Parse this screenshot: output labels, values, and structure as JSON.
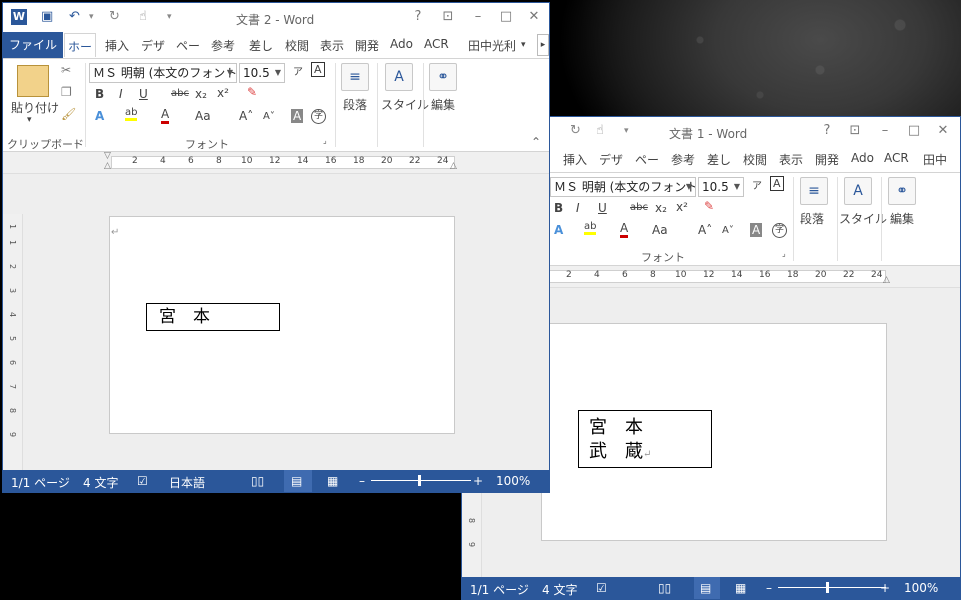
{
  "colors": {
    "accent": "#2b579a",
    "status_bar": "#2b579a"
  },
  "icons": [
    "word-icon",
    "save-icon",
    "undo-icon",
    "redo-icon",
    "touch-mode-icon",
    "customize-icon",
    "help-icon",
    "ribbon-display-icon",
    "minimize-icon",
    "maximize-icon",
    "close-icon",
    "paste-icon",
    "cut-icon",
    "copy-icon",
    "format-painter-icon",
    "clear-format-icon",
    "phonetic-icon",
    "enclose-icon",
    "find-binoculars-icon",
    "paragraph-icon",
    "styles-icon"
  ],
  "back_window": {
    "title": "文書 1 - Word",
    "tabs": [
      "挿入",
      "デザ",
      "ペー",
      "参考",
      "差し",
      "校閲",
      "表示",
      "開発",
      "Ado",
      "ACR",
      "田中"
    ],
    "font_name": "ＭＳ 明朝 (本文のフォント",
    "font_size": "10.5",
    "groups": {
      "font": "フォント",
      "paragraph": "段落",
      "styles": "スタイル",
      "editing": "編集"
    },
    "ruler_numbers": [
      "2",
      "4",
      "6",
      "8",
      "10",
      "12",
      "14",
      "16",
      "18",
      "20",
      "22",
      "24"
    ],
    "vruler_numbers": [
      "8",
      "9"
    ],
    "textbox_lines": [
      "宮　本",
      "武　蔵"
    ],
    "status": {
      "page": "1/1 ページ",
      "words": "4 文字",
      "zoom": "100%"
    }
  },
  "front_window": {
    "title": "文書 2 - Word",
    "file_tab": "ファイル",
    "home_tab": "ホー",
    "tabs": [
      "挿入",
      "デザ",
      "ペー",
      "参考",
      "差し",
      "校閲",
      "表示",
      "開発",
      "Ado",
      "ACR"
    ],
    "user": "田中光利",
    "font_name": "ＭＳ 明朝 (本文のフォント",
    "font_size": "10.5",
    "paste_label": "貼り付け",
    "groups": {
      "clipboard": "クリップボード",
      "font": "フォント",
      "paragraph": "段落",
      "styles": "スタイル",
      "editing": "編集"
    },
    "ruler_numbers": [
      "2",
      "4",
      "6",
      "8",
      "10",
      "12",
      "14",
      "16",
      "18",
      "20",
      "22",
      "24"
    ],
    "vruler_numbers": [
      "1",
      "1",
      "2",
      "3",
      "4",
      "5",
      "6",
      "7",
      "8",
      "9"
    ],
    "textbox_text": "宮　本",
    "status": {
      "page": "1/1 ページ",
      "words": "4 文字",
      "language": "日本語",
      "zoom": "100%"
    }
  }
}
